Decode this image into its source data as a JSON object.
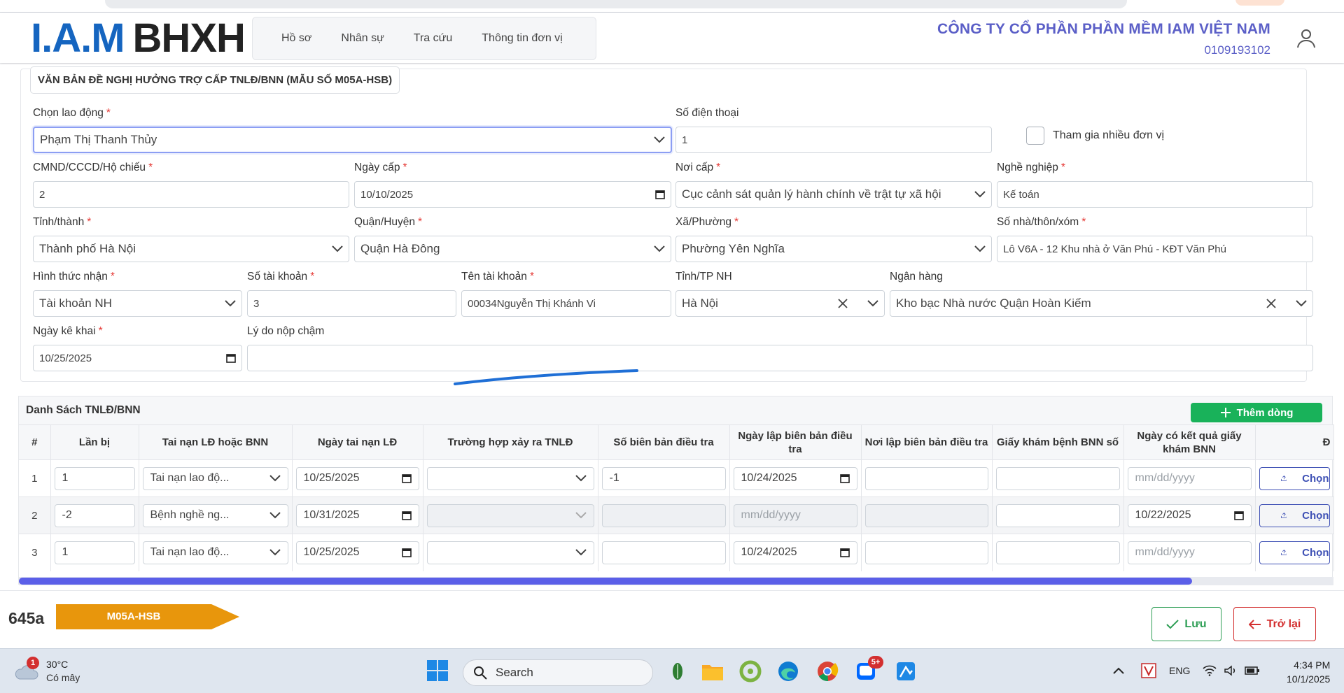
{
  "header": {
    "logo_main": "I.A.M",
    "logo_bhxh": "BHXH",
    "nav": [
      "Hồ sơ",
      "Nhân sự",
      "Tra cứu",
      "Thông tin đơn vị"
    ],
    "company_name": "CÔNG TY CỔ PHẦN PHẦN MỀM IAM VIỆT NAM",
    "tax_code": "0109193102"
  },
  "form": {
    "title": "VĂN BẢN ĐỀ NGHỊ HƯỞNG TRỢ CẤP TNLĐ/BNN (MẪU SỐ M05A-HSB)",
    "required_mark": "*",
    "employee": {
      "label": "Chọn lao động",
      "value": "Phạm Thị Thanh Thủy"
    },
    "phone": {
      "label": "Số điện thoại",
      "value": "1"
    },
    "multi_unit": {
      "label": "Tham gia nhiều đơn vị",
      "checked": false
    },
    "id_number": {
      "label": "CMND/CCCD/Hộ chiếu",
      "value": "2"
    },
    "issue_date": {
      "label": "Ngày cấp",
      "value": "10/10/2025"
    },
    "issue_place": {
      "label": "Nơi cấp",
      "value": "Cục cảnh sát quản lý hành chính về trật tự xã hội"
    },
    "occupation": {
      "label": "Nghề nghiệp",
      "value": "Kế toán"
    },
    "province": {
      "label": "Tỉnh/thành",
      "value": "Thành phố Hà Nội"
    },
    "district": {
      "label": "Quận/Huyện",
      "value": "Quận Hà Đông"
    },
    "ward": {
      "label": "Xã/Phường",
      "value": "Phường Yên Nghĩa"
    },
    "address": {
      "label": "Số nhà/thôn/xóm",
      "value": "Lô V6A - 12 Khu nhà ở Văn Phú - KĐT Văn Phú"
    },
    "receive_method": {
      "label": "Hình thức nhận",
      "value": "Tài khoản NH"
    },
    "account_no": {
      "label": "Số tài khoản",
      "value": "3"
    },
    "account_name": {
      "label": "Tên tài khoản",
      "value": "00034Nguyễn Thị Khánh Vi"
    },
    "bank_province": {
      "label": "Tỉnh/TP NH",
      "value": "Hà Nội"
    },
    "bank": {
      "label": "Ngân hàng",
      "value": "Kho bạc Nhà nước Quận Hoàn Kiếm"
    },
    "declare_date": {
      "label": "Ngày kê khai",
      "value": "10/25/2025"
    },
    "late_reason": {
      "label": "Lý do nộp chậm",
      "value": ""
    }
  },
  "table": {
    "title": "Danh Sách TNLĐ/BNN",
    "add_label": "Thêm dòng",
    "date_placeholder": "mm/dd/yyyy",
    "upload_label": "Chọn",
    "columns": [
      "#",
      "Lần bị",
      "Tai nạn LĐ hoặc BNN",
      "Ngày tai nạn LĐ",
      "Trường hợp xảy ra TNLĐ",
      "Số biên bản điều tra",
      "Ngày lập biên bản điều tra",
      "Nơi lập biên bản điều tra",
      "Giấy khám bệnh BNN số",
      "Ngày có kết quả giấy khám BNN",
      "Đ"
    ],
    "rows": [
      {
        "idx": "1",
        "times": "1",
        "type": "Tai nạn lao độ...",
        "accident_date": "10/25/2025",
        "case": "",
        "report_no": "-1",
        "report_date": "10/24/2025",
        "report_place": "",
        "bnn_no": "",
        "result_date": ""
      },
      {
        "idx": "2",
        "times": "-2",
        "type": "Bệnh nghề ng...",
        "accident_date": "10/31/2025",
        "case": "",
        "report_no": "",
        "report_date": "",
        "report_place": "",
        "bnn_no": "",
        "result_date": "10/22/2025"
      },
      {
        "idx": "3",
        "times": "1",
        "type": "Tai nạn lao độ...",
        "accident_date": "10/25/2025",
        "case": "",
        "report_no": "",
        "report_date": "10/24/2025",
        "report_place": "",
        "bnn_no": "",
        "result_date": ""
      }
    ]
  },
  "footer": {
    "code": "645a",
    "form_tag": "M05A-HSB",
    "save_label": "Lưu",
    "back_label": "Trở lại",
    "tag_color": "#e8960c"
  },
  "taskbar": {
    "weather_badge": "1",
    "temperature": "30°C",
    "condition": "Có mây",
    "search_placeholder": "Search",
    "zalo_badge": "5+",
    "lang": "ENG",
    "time": "4:34 PM",
    "date": "10/1/2025"
  }
}
